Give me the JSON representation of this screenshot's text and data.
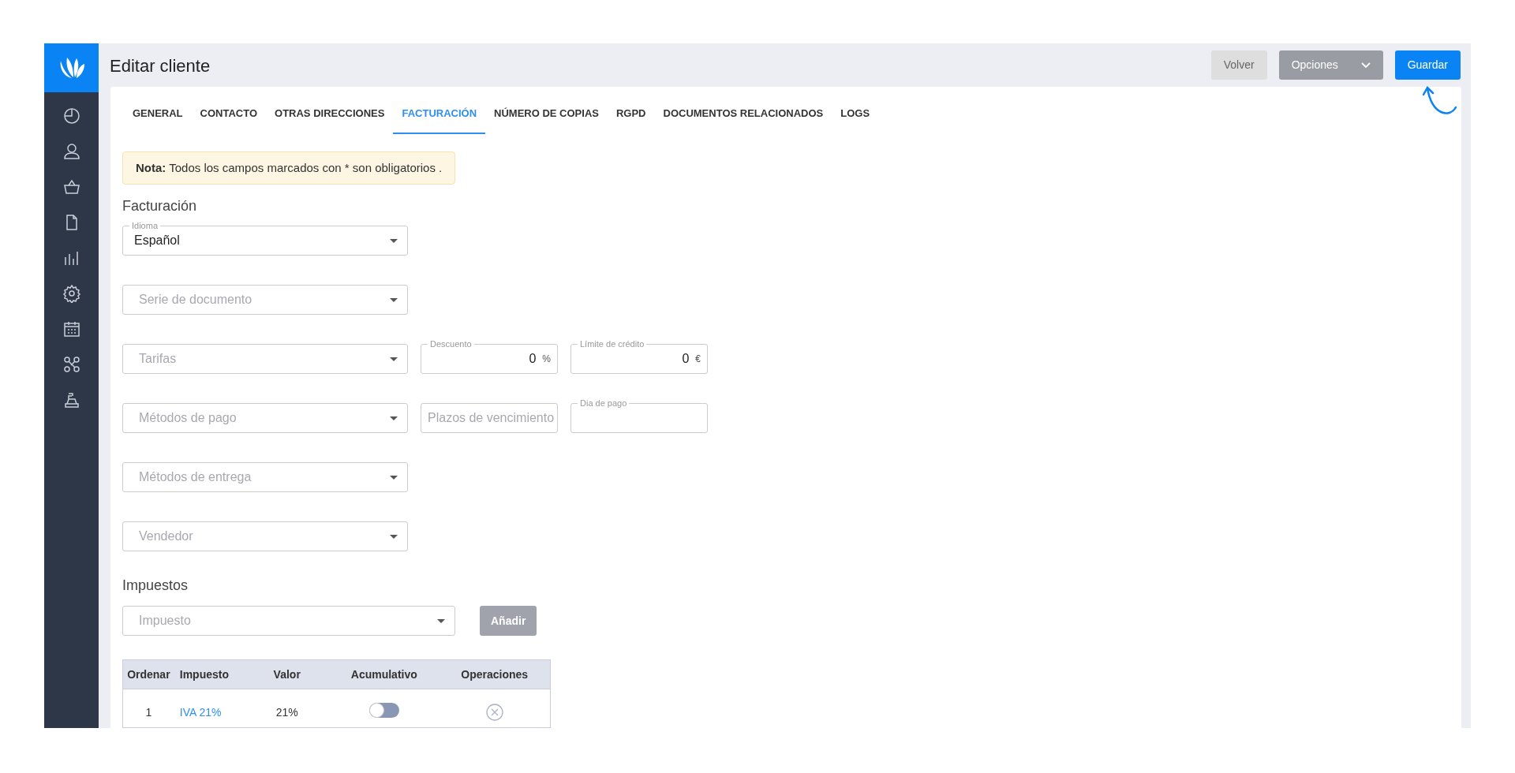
{
  "header": {
    "title": "Editar cliente",
    "buttons": [
      {
        "label": "Volver",
        "kind": "secondary"
      },
      {
        "label": "Opciones",
        "kind": "dropdown"
      },
      {
        "label": "Guardar",
        "kind": "primary"
      }
    ]
  },
  "tabs": [
    {
      "label": "GENERAL",
      "selected": false
    },
    {
      "label": "CONTACTO",
      "selected": false
    },
    {
      "label": "OTRAS DIRECCIONES",
      "selected": false
    },
    {
      "label": "FACTURACIÓN",
      "selected": true
    },
    {
      "label": "NÚMERO DE COPIAS",
      "selected": false
    },
    {
      "label": "RGPD",
      "selected": false
    },
    {
      "label": "DOCUMENTOS RELACIONADOS",
      "selected": false
    },
    {
      "label": "LOGS",
      "selected": false
    }
  ],
  "note": "**Nota:** Todos los campos marcados con * son obligatorios .",
  "billing": {
    "title": "Facturación",
    "rows": [
      [
        {
          "kind": "select",
          "label": "Idioma",
          "value": "Español"
        }
      ],
      [
        {
          "kind": "select",
          "placeholder": "Serie de documento"
        }
      ],
      [
        {
          "kind": "select",
          "placeholder": "Tarifas"
        },
        {
          "kind": "number",
          "label": "Descuento",
          "value": "0",
          "unit": "%"
        },
        {
          "kind": "number",
          "label": "Límite de crédito",
          "value": "0",
          "unit": "€"
        }
      ],
      [
        {
          "kind": "select",
          "placeholder": "Métodos de pago"
        },
        {
          "kind": "text",
          "placeholder": "Plazos de vencimiento"
        },
        {
          "kind": "text",
          "label": "Dia de pago"
        }
      ],
      [
        {
          "kind": "select",
          "placeholder": "Métodos de entrega"
        }
      ],
      [
        {
          "kind": "select",
          "placeholder": "Vendedor"
        }
      ]
    ]
  },
  "taxes": {
    "title": "Impuestos",
    "select": {
      "placeholder": "Impuesto"
    },
    "add_button": "Añadir",
    "table": {
      "columns": [
        "Ordenar",
        "Impuesto",
        "Valor",
        "Acumulativo",
        "Operaciones"
      ],
      "rows": [
        {
          "order": "1",
          "tax": "IVA 21%",
          "value": "21%",
          "cumulative": false
        }
      ]
    }
  }
}
